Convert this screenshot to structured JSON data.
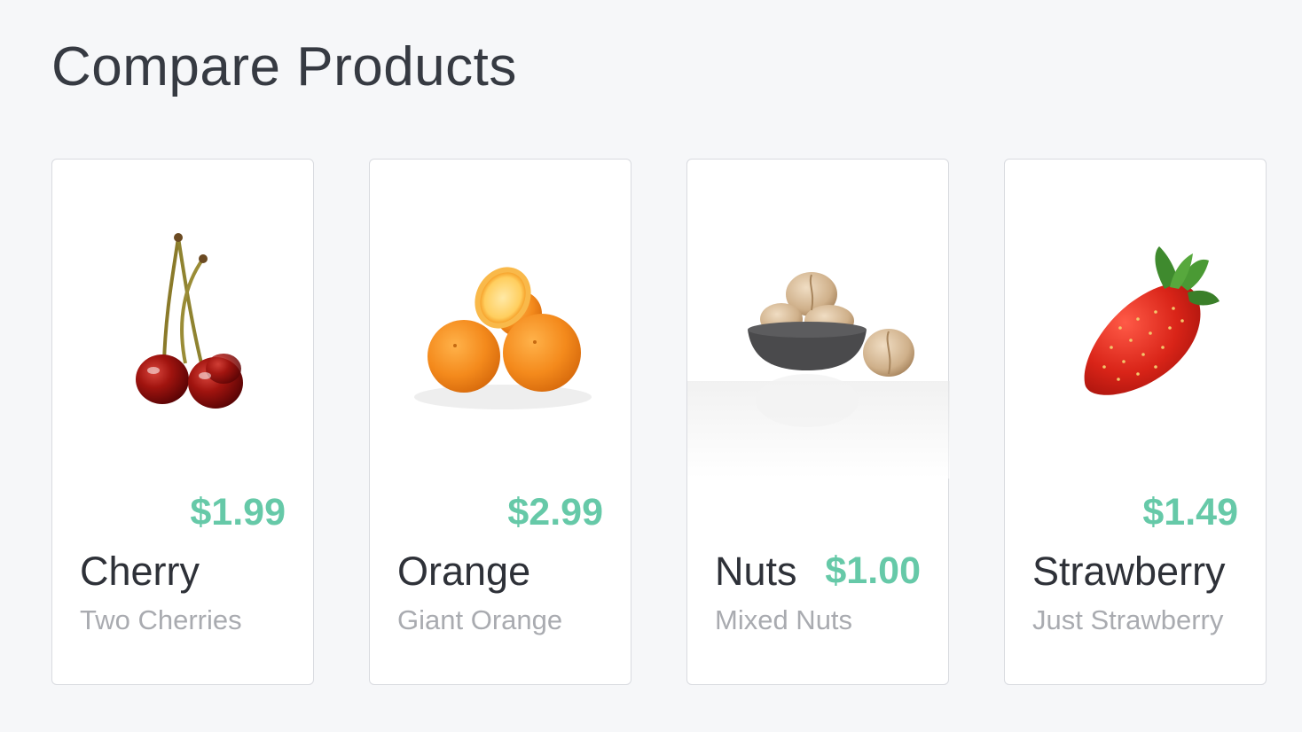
{
  "page": {
    "title": "Compare Products"
  },
  "products": [
    {
      "name": "Cherry",
      "description": "Two Cherries",
      "price": "$1.99",
      "image": "cherries-image"
    },
    {
      "name": "Orange",
      "description": "Giant Orange",
      "price": "$2.99",
      "image": "oranges-image"
    },
    {
      "name": "Nuts",
      "description": "Mixed Nuts",
      "price": "$1.00",
      "image": "walnuts-bowl-image"
    },
    {
      "name": "Strawberry",
      "description": "Just Strawberry",
      "price": "$1.49",
      "image": "strawberry-image"
    }
  ],
  "colors": {
    "price": "#66c9a8",
    "title": "#363a42",
    "name": "#2e3138",
    "description": "#a9abb0",
    "background": "#f6f7f9"
  }
}
